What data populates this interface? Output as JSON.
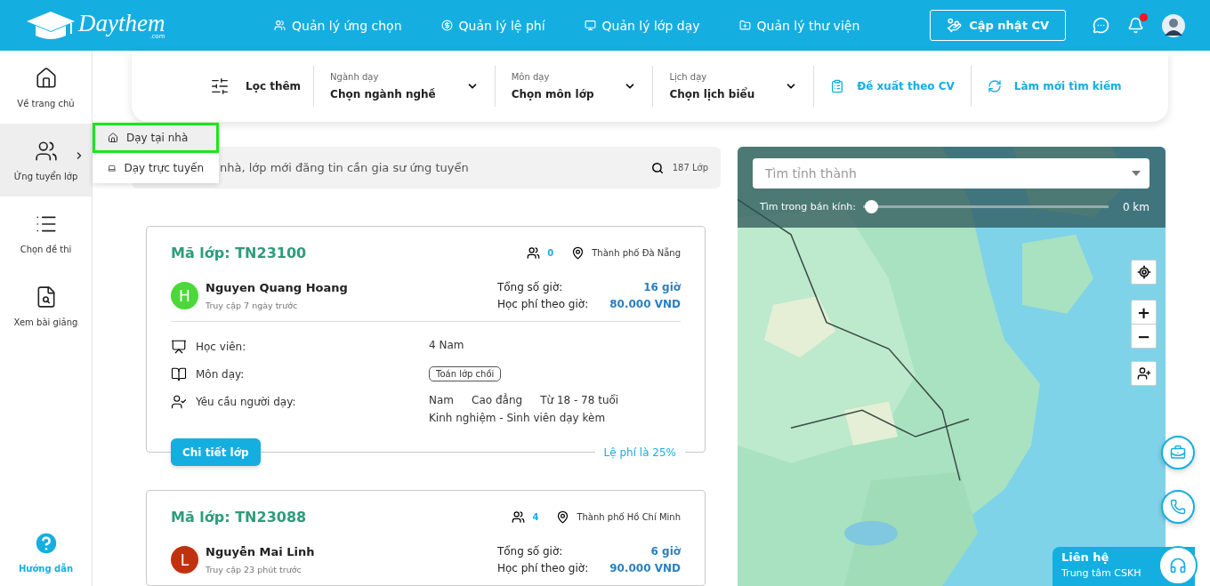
{
  "header": {
    "logo": "Daythem",
    "logo_sub": ".com",
    "nav": [
      {
        "label": "Quản lý ứng chọn"
      },
      {
        "label": "Quản lý lệ phí"
      },
      {
        "label": "Quản lý lớp dạy"
      },
      {
        "label": "Quản lý thư viện"
      }
    ],
    "cv_button": "Cập nhật CV",
    "has_notification": true
  },
  "sidebar": {
    "items": [
      {
        "label": "Về trang chủ",
        "selected": false,
        "expanded": false
      },
      {
        "label": "Ứng tuyển lớp",
        "selected": true,
        "expanded": true
      },
      {
        "label": "Chọn đề thi",
        "selected": false,
        "expanded": false
      },
      {
        "label": "Xem bài giảng",
        "selected": false,
        "expanded": false
      }
    ],
    "help": "Hướng dẫn"
  },
  "submenu": [
    {
      "label": "Dạy tại nhà",
      "selected": true
    },
    {
      "label": "Dạy trực tuyến",
      "selected": false
    }
  ],
  "filters": {
    "more": "Lọc thêm",
    "dropdowns": [
      {
        "label": "Ngành dạy",
        "value": "Chọn ngành nghề"
      },
      {
        "label": "Môn dạy",
        "value": "Chọn môn lớp"
      },
      {
        "label": "Lịch dạy",
        "value": "Chọn lịch biểu"
      }
    ],
    "actions": [
      {
        "label": "Đề xuất theo CV"
      },
      {
        "label": "Làm mới tìm kiếm"
      }
    ]
  },
  "search": {
    "text": "nhà, lớp mới đăng tin cần gia sư ứng tuyển",
    "count": "187 Lớp"
  },
  "classes": [
    {
      "code": "Mã lớp: TN23100",
      "applicants": "0",
      "location": "Thành phố Đà Nẵng",
      "initial": "H",
      "color": "#4cd83a",
      "name": "Nguyen Quang Hoang",
      "last_seen": "Truy cập 7 ngày trước",
      "hours_label": "Tổng số giờ:",
      "hours": "16 giờ",
      "fee_label": "Học phí theo giờ:",
      "fee": "80.000 VND",
      "details": [
        {
          "kind": "text",
          "label": "Học viên:",
          "values": [
            "4 Nam"
          ]
        },
        {
          "kind": "tag",
          "label": "Môn dạy:",
          "values": [
            "Toán lớp chồi"
          ]
        },
        {
          "kind": "list",
          "label": "Yêu cầu người dạy:",
          "values": [
            "Nam",
            "Cao đẳng",
            "Từ 18 - 78 tuổi"
          ],
          "extra": "Kinh nghiệm - Sinh viên dạy kèm"
        }
      ],
      "button": "Chi tiết lớp",
      "fee_note": "Lệ phí là 25%"
    },
    {
      "code": "Mã lớp: TN23088",
      "applicants": "4",
      "location": "Thành phố Hồ Chí Minh",
      "initial": "L",
      "color": "#c0320f",
      "name": "Nguyễn Mai Linh",
      "last_seen": "Truy cập 23 phút trước",
      "hours_label": "Tổng số giờ:",
      "hours": "6 giờ",
      "fee_label": "Học phí theo giờ:",
      "fee": "90.000 VND"
    }
  ],
  "map": {
    "kind": "picture",
    "province_placeholder": "Tìm tỉnh thành",
    "radius_label": "Tìm trong bán kính:",
    "radius": {
      "level": 0
    },
    "radius_reading": "0 km",
    "zoom_in": "+",
    "zoom_out": "−"
  },
  "contact": {
    "title": "Liên hệ",
    "subtitle": "Trung tâm CSKH"
  }
}
